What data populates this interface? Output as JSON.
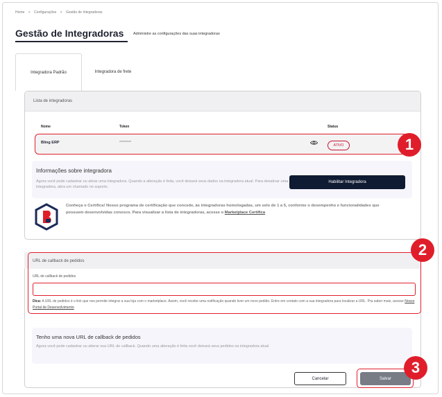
{
  "breadcrumb": [
    "Home",
    ">",
    "Configurações",
    ">",
    "Gestão de Integradoras"
  ],
  "header": {
    "title": "Gestão de Integradoras",
    "subtitle": "Administre as configurações das suas integradoras"
  },
  "tabs": [
    {
      "label": "Integradora Padrão",
      "active": true
    },
    {
      "label": "Integradora de frete",
      "active": false
    }
  ],
  "integrators": {
    "header": "Lista de integradoras",
    "columns": {
      "name": "Nome",
      "token": "Token",
      "status": "Status"
    },
    "rows": [
      {
        "name": "Bling ERP",
        "token": "********",
        "status": "ATIVO"
      }
    ]
  },
  "info": {
    "title": "Informações sobre integradora",
    "text": "Agora você pode cadastrar ou ativar uma integradora. Quando a alteração é feita, você deixará seus dados na integradora atual. Para desativar uma integradora, abra um chamado no suporte.",
    "button": "Habilitar Integradora"
  },
  "certificate": {
    "text": "Conheça o Certifica! Nosso programa de certificação que concede, às integradoras homologadas, um selo de 1 a 5, conforme o desempenho e funcionalidades que possuem desenvolvidas conosco. Para visualizar a lista de integradoras, acesse o ",
    "link": "Marketplace Certifica"
  },
  "callback": {
    "header": "URL de callback de pedidos",
    "field_label": "URL de callback de pedidos",
    "field_value": "",
    "hint_prefix": "Dica:",
    "hint_text": " A URL de pedidos é o link que nos permite integrar a sua loja com o marketplace. Assim, você recebe uma notificação quando tiver um novo pedido. Entre em contato com a sua integradora para localizar a URL. Pra saber mais, acesse ",
    "hint_link": "Nosso Portal de Desenvolvimento"
  },
  "new_url": {
    "title": "Tenho uma nova URL de callback de pedidos",
    "text": "Agora você pode cadastrar ou alterar sua URL de callback. Quando uma alteração é feita você deixará seus pedidos na integradora atual"
  },
  "actions": {
    "cancel": "Cancelar",
    "save": "Salvar"
  },
  "markers": [
    "1",
    "2",
    "3"
  ],
  "colors": {
    "accent": "#e01e2b",
    "primary": "#0f1a33",
    "status": "#c8102e"
  }
}
